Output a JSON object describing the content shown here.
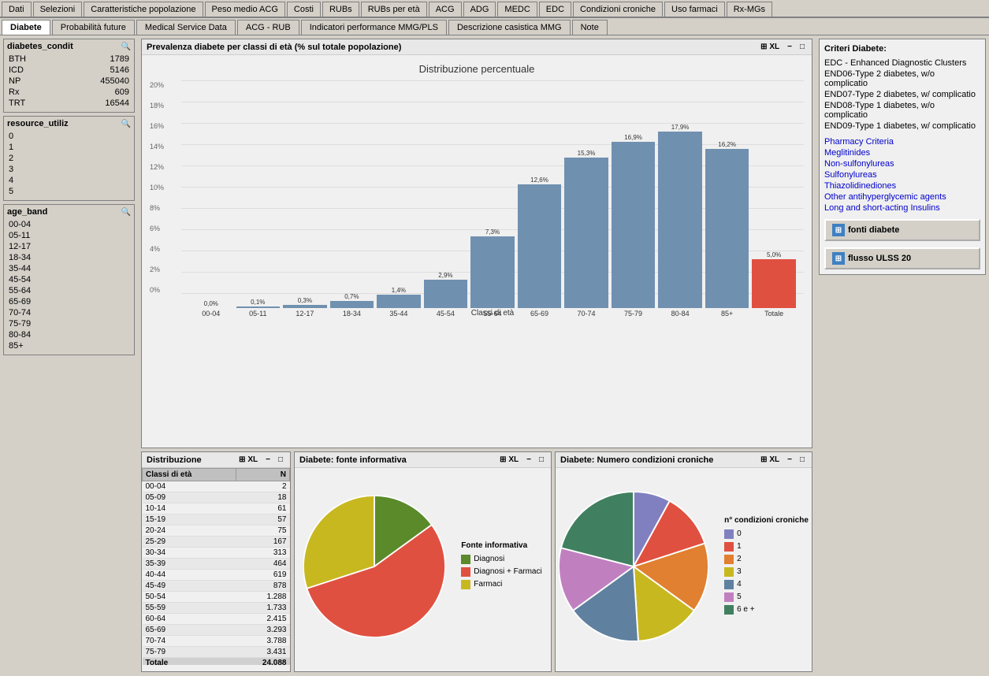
{
  "topTabs": [
    {
      "label": "Dati",
      "active": false
    },
    {
      "label": "Selezioni",
      "active": false
    },
    {
      "label": "Caratteristiche popolazione",
      "active": false
    },
    {
      "label": "Peso medio ACG",
      "active": false
    },
    {
      "label": "Costi",
      "active": false
    },
    {
      "label": "RUBs",
      "active": false
    },
    {
      "label": "RUBs per età",
      "active": false
    },
    {
      "label": "ACG",
      "active": false
    },
    {
      "label": "ADG",
      "active": false
    },
    {
      "label": "MEDC",
      "active": false
    },
    {
      "label": "EDC",
      "active": false
    },
    {
      "label": "Condizioni croniche",
      "active": false
    },
    {
      "label": "Uso farmaci",
      "active": false
    },
    {
      "label": "Rx-MGs",
      "active": false
    }
  ],
  "secondTabs": [
    {
      "label": "Diabete",
      "active": true
    },
    {
      "label": "Probabilità future",
      "active": false
    },
    {
      "label": "Medical Service Data",
      "active": false
    },
    {
      "label": "ACG - RUB",
      "active": false
    },
    {
      "label": "Indicatori performance MMG/PLS",
      "active": false
    },
    {
      "label": "Descrizione casistica MMG",
      "active": false
    },
    {
      "label": "Note",
      "active": false
    }
  ],
  "filters": {
    "diabetes_condit": {
      "label": "diabetes_condit",
      "items": [
        {
          "name": "BTH",
          "value": "1789"
        },
        {
          "name": "ICD",
          "value": "5146"
        },
        {
          "name": "NP",
          "value": "455040"
        },
        {
          "name": "Rx",
          "value": "609"
        },
        {
          "name": "TRT",
          "value": "16544"
        }
      ]
    },
    "resource_utiliz": {
      "label": "resource_utiliz",
      "items": [
        {
          "name": "0",
          "value": ""
        },
        {
          "name": "1",
          "value": ""
        },
        {
          "name": "2",
          "value": ""
        },
        {
          "name": "3",
          "value": ""
        },
        {
          "name": "4",
          "value": ""
        },
        {
          "name": "5",
          "value": ""
        }
      ]
    },
    "age_band": {
      "label": "age_band",
      "items": [
        {
          "name": "00-04",
          "value": ""
        },
        {
          "name": "05-11",
          "value": ""
        },
        {
          "name": "12-17",
          "value": ""
        },
        {
          "name": "18-34",
          "value": ""
        },
        {
          "name": "35-44",
          "value": ""
        },
        {
          "name": "45-54",
          "value": ""
        },
        {
          "name": "55-64",
          "value": ""
        },
        {
          "name": "65-69",
          "value": ""
        },
        {
          "name": "70-74",
          "value": ""
        },
        {
          "name": "75-79",
          "value": ""
        },
        {
          "name": "80-84",
          "value": ""
        },
        {
          "name": "85+",
          "value": ""
        }
      ]
    }
  },
  "mainChart": {
    "title": "Prevalenza diabete per classi di età (% sul totale popolazione)",
    "subtitle": "Distribuzione percentuale",
    "xLabel": "Classi di età",
    "yLabels": [
      "0%",
      "2%",
      "4%",
      "6%",
      "8%",
      "10%",
      "12%",
      "14%",
      "16%",
      "18%",
      "20%"
    ],
    "bars": [
      {
        "label": "00-04",
        "value": 0.0,
        "display": "0,0%",
        "heightPct": 0
      },
      {
        "label": "05-11",
        "value": 0.1,
        "display": "0,1%",
        "heightPct": 0.5
      },
      {
        "label": "12-17",
        "value": 0.3,
        "display": "0,3%",
        "heightPct": 1.5
      },
      {
        "label": "18-34",
        "value": 0.7,
        "display": "0,7%",
        "heightPct": 3.5
      },
      {
        "label": "35-44",
        "value": 1.4,
        "display": "1,4%",
        "heightPct": 7
      },
      {
        "label": "45-54",
        "value": 2.9,
        "display": "2,9%",
        "heightPct": 14.5
      },
      {
        "label": "55-64",
        "value": 7.3,
        "display": "7,3%",
        "heightPct": 36.5
      },
      {
        "label": "65-69",
        "value": 12.6,
        "display": "12,6%",
        "heightPct": 63
      },
      {
        "label": "70-74",
        "value": 15.3,
        "display": "15,3%",
        "heightPct": 76.5
      },
      {
        "label": "75-79",
        "value": 16.9,
        "display": "16,9%",
        "heightPct": 84.5
      },
      {
        "label": "80-84",
        "value": 17.9,
        "display": "17,9%",
        "heightPct": 89.5
      },
      {
        "label": "85+",
        "value": 16.2,
        "display": "16,2%",
        "heightPct": 81
      },
      {
        "label": "Totale",
        "value": 5.0,
        "display": "5,0%",
        "heightPct": 25,
        "special": true
      }
    ],
    "controls": [
      "⊞ XL",
      "−",
      "□"
    ]
  },
  "criteria": {
    "title": "Criteri Diabete:",
    "edc": [
      "EDC - Enhanced Diagnostic Clusters",
      "END06-Type 2 diabetes, w/o complicatio",
      "END07-Type 2 diabetes, w/ complicatio",
      "END08-Type 1 diabetes, w/o complicatio",
      "END09-Type 1 diabetes, w/ complicatio"
    ],
    "pharmacy": {
      "title": "Pharmacy Criteria",
      "items": [
        "Meglitinides",
        "Non-sulfonylureas",
        "Sulfonylureas",
        "Thiazolidinediones",
        "Other antihyperglycemic agents",
        "Long and short-acting Insulins"
      ]
    },
    "buttons": [
      {
        "label": "fonti diabete"
      },
      {
        "label": "flusso ULSS 20"
      }
    ]
  },
  "distribuzione": {
    "title": "Distribuzione",
    "headers": [
      "Classi di età",
      "N"
    ],
    "rows": [
      {
        "age": "00-04",
        "n": "2"
      },
      {
        "age": "05-09",
        "n": "18"
      },
      {
        "age": "10-14",
        "n": "61"
      },
      {
        "age": "15-19",
        "n": "57"
      },
      {
        "age": "20-24",
        "n": "75"
      },
      {
        "age": "25-29",
        "n": "167"
      },
      {
        "age": "30-34",
        "n": "313"
      },
      {
        "age": "35-39",
        "n": "464"
      },
      {
        "age": "40-44",
        "n": "619"
      },
      {
        "age": "45-49",
        "n": "878"
      },
      {
        "age": "50-54",
        "n": "1.288"
      },
      {
        "age": "55-59",
        "n": "1.733"
      },
      {
        "age": "60-64",
        "n": "2.415"
      },
      {
        "age": "65-69",
        "n": "3.293"
      },
      {
        "age": "70-74",
        "n": "3.788"
      },
      {
        "age": "75-79",
        "n": "3.431"
      }
    ],
    "total": {
      "label": "Totale",
      "n": "24.088"
    },
    "controls": [
      "⊞ XL",
      "−",
      "□"
    ]
  },
  "fonteInformativa": {
    "title": "Diabete: fonte informativa",
    "controls": [
      "⊞ XL",
      "−",
      "□"
    ],
    "legend": {
      "title": "Fonte informativa",
      "items": [
        {
          "label": "Diagnosi",
          "color": "#5a8a2a"
        },
        {
          "label": "Diagnosi + Farmaci",
          "color": "#e05040"
        },
        {
          "label": "Farmaci",
          "color": "#c8b820"
        }
      ]
    },
    "pieData": [
      {
        "label": "Diagnosi",
        "color": "#5a8a2a",
        "pct": 15
      },
      {
        "label": "Diagnosi + Farmaci",
        "color": "#e05040",
        "pct": 55
      },
      {
        "label": "Farmaci",
        "color": "#c8b820",
        "pct": 30
      }
    ]
  },
  "condizioniCroniche": {
    "title": "Diabete: Numero condizioni croniche",
    "controls": [
      "⊞ XL",
      "−",
      "□"
    ],
    "legend": {
      "title": "n° condizioni croniche",
      "items": [
        {
          "label": "0",
          "color": "#8080c0"
        },
        {
          "label": "1",
          "color": "#e05040"
        },
        {
          "label": "2",
          "color": "#e08030"
        },
        {
          "label": "3",
          "color": "#c8b820"
        },
        {
          "label": "4",
          "color": "#6080a0"
        },
        {
          "label": "5",
          "color": "#c080c0"
        },
        {
          "label": "6 e +",
          "color": "#408060"
        }
      ]
    },
    "pieData": [
      {
        "label": "0",
        "color": "#8080c0",
        "pct": 8
      },
      {
        "label": "1",
        "color": "#e05040",
        "pct": 12
      },
      {
        "label": "2",
        "color": "#e08030",
        "pct": 15
      },
      {
        "label": "3",
        "color": "#c8b820",
        "pct": 14
      },
      {
        "label": "4",
        "color": "#6080a0",
        "pct": 16
      },
      {
        "label": "5",
        "color": "#c080c0",
        "pct": 14
      },
      {
        "label": "6 e +",
        "color": "#408060",
        "pct": 21
      }
    ]
  }
}
